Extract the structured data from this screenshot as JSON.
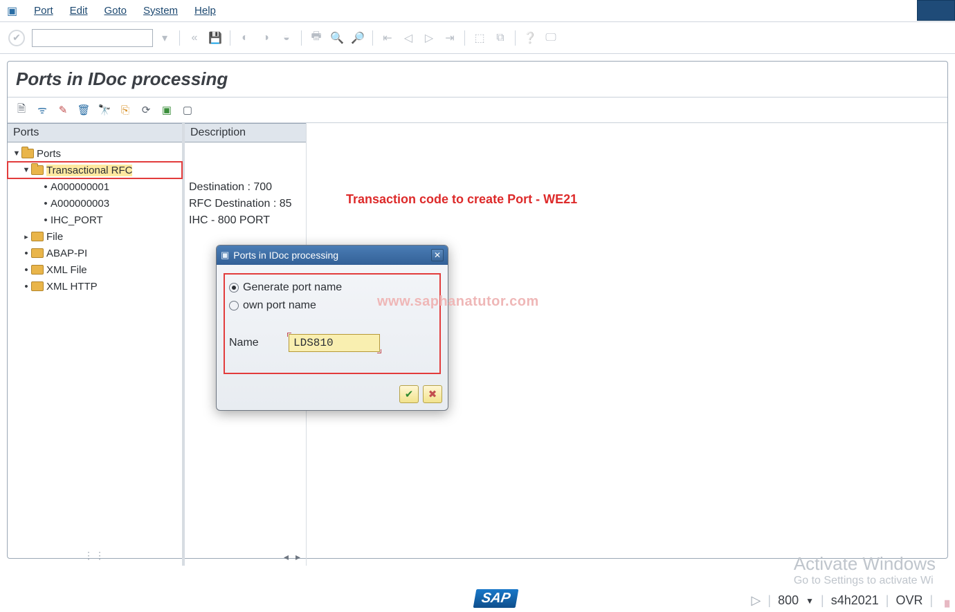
{
  "menubar": {
    "items": [
      "Port",
      "Edit",
      "Goto",
      "System",
      "Help"
    ]
  },
  "page": {
    "title": "Ports in IDoc processing"
  },
  "columns": {
    "ports": "Ports",
    "description": "Description"
  },
  "tree": {
    "root": "Ports",
    "node_trfc": "Transactional RFC",
    "leaf_a1": "A000000001",
    "leaf_a3": "A000000003",
    "leaf_ihc": "IHC_PORT",
    "node_file": "File",
    "node_abappi": "ABAP-PI",
    "node_xmlfile": "XML File",
    "node_xmlhttp": "XML HTTP"
  },
  "descriptions": {
    "a1": "Destination : 700",
    "a3": "RFC Destination : 85",
    "ihc": "IHC - 800 PORT"
  },
  "dialog": {
    "title": "Ports in IDoc processing",
    "radio_generate": "Generate port name",
    "radio_own": "own port name",
    "name_label": "Name",
    "name_value": "LDS810"
  },
  "overlay": {
    "instruction": "Transaction code to create Port - WE21",
    "watermark": "www.saphanatutor.com"
  },
  "status": {
    "client": "800",
    "system": "s4h2021",
    "mode": "OVR"
  },
  "sap_logo": "SAP",
  "activate": {
    "l1": "Activate Windows",
    "l2": "Go to Settings to activate Wi"
  }
}
